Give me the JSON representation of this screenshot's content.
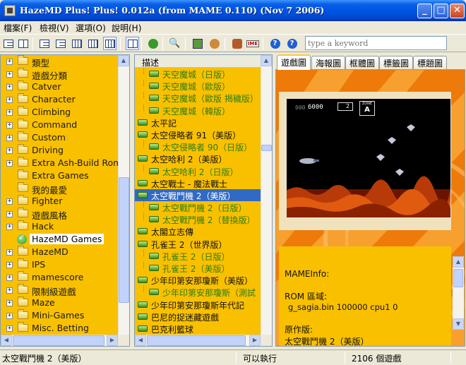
{
  "window": {
    "title": "HazeMD Plus! Plus! 0.012a (from MAME 0.110) (Nov  7 2006)"
  },
  "menu": [
    {
      "label": "檔案(F)"
    },
    {
      "label": "檢視(V)"
    },
    {
      "label": "選項(O)"
    },
    {
      "label": "說明(H)"
    }
  ],
  "toolbar": {
    "search_placeholder": "type a keyword",
    "icons": [
      "large-icons",
      "small-icons",
      "list-view",
      "details-view",
      "grouped-view",
      "folder-pane",
      "view-toggle",
      "refresh",
      "find",
      "play",
      "options",
      "plugins",
      "ime",
      "help",
      "about"
    ]
  },
  "folders": [
    {
      "label": "類型",
      "expander": "+",
      "icon": "folder"
    },
    {
      "label": "遊戲分類",
      "expander": "+",
      "icon": "folder"
    },
    {
      "label": "Catver",
      "expander": "+",
      "icon": "folder"
    },
    {
      "label": "Character",
      "expander": "+",
      "icon": "folder"
    },
    {
      "label": "Climbing",
      "expander": "+",
      "icon": "folder"
    },
    {
      "label": "Command",
      "expander": "+",
      "icon": "folder"
    },
    {
      "label": "Custom",
      "expander": "+",
      "icon": "folder"
    },
    {
      "label": "Driving",
      "expander": "+",
      "icon": "folder"
    },
    {
      "label": "Extra Ash-Build Rom",
      "expander": "+",
      "icon": "folder"
    },
    {
      "label": "Extra Games",
      "expander": "",
      "icon": "folder"
    },
    {
      "label": "我的最愛",
      "expander": "",
      "icon": "folder"
    },
    {
      "label": "Fighter",
      "expander": "+",
      "icon": "folder"
    },
    {
      "label": "遊戲風格",
      "expander": "+",
      "icon": "folder"
    },
    {
      "label": "Hack",
      "expander": "+",
      "icon": "folder"
    },
    {
      "label": "HazeMD Games",
      "expander": "",
      "icon": "check",
      "selected": true
    },
    {
      "label": "HazeMD",
      "expander": "+",
      "icon": "folder"
    },
    {
      "label": "IPS",
      "expander": "+",
      "icon": "folder"
    },
    {
      "label": "mamescore",
      "expander": "+",
      "icon": "folder"
    },
    {
      "label": "限制級遊戲",
      "expander": "+",
      "icon": "folder"
    },
    {
      "label": "Maze",
      "expander": "+",
      "icon": "folder"
    },
    {
      "label": "Mini-Games",
      "expander": "+",
      "icon": "folder"
    },
    {
      "label": "Misc. Betting",
      "expander": "+",
      "icon": "folder"
    }
  ],
  "list_header": {
    "description": "描述"
  },
  "games": [
    {
      "label": "天空魔城（日版）",
      "clone": true
    },
    {
      "label": "天空魔城（歐版）",
      "clone": true
    },
    {
      "label": "天空魔城（歐版 揭穢版）",
      "clone": true
    },
    {
      "label": "天空魔城（韓版）",
      "clone": true
    },
    {
      "label": "太平記",
      "clone": false
    },
    {
      "label": "太空侵略者 91（美版）",
      "clone": false
    },
    {
      "label": "太空侵略者 90（日版）",
      "clone": true
    },
    {
      "label": "太空哈利 2（美版）",
      "clone": false
    },
    {
      "label": "太空哈利 2（日版）",
      "clone": true
    },
    {
      "label": "太空戰士 - 魔法戰士",
      "clone": false
    },
    {
      "label": "太空戰鬥機 2（美版）",
      "clone": false,
      "selected": true
    },
    {
      "label": "太空戰鬥機 2（日版）",
      "clone": true
    },
    {
      "label": "太空戰鬥機 2（替換版）",
      "clone": true
    },
    {
      "label": "太閣立志傳",
      "clone": false
    },
    {
      "label": "孔雀王 2（世界版）",
      "clone": false
    },
    {
      "label": "孔雀王 2（日版）",
      "clone": true
    },
    {
      "label": "孔雀王 2（美版）",
      "clone": true
    },
    {
      "label": "少年印第安那瓊斯（美版）",
      "clone": false
    },
    {
      "label": "少年印第安那瓊斯（測試",
      "clone": true
    },
    {
      "label": "少年印第安那瓊斯年代記",
      "clone": false
    },
    {
      "label": "巴尼的捉迷藏遊戲",
      "clone": false
    },
    {
      "label": "巴克利籃球",
      "clone": false
    }
  ],
  "tabs": [
    {
      "label": "遊戲圖",
      "active": true
    },
    {
      "label": "海報圖"
    },
    {
      "label": "框體圖"
    },
    {
      "label": "標籤圖"
    },
    {
      "label": "標題圖"
    }
  ],
  "screenshot": {
    "score": "6000",
    "lives": "2",
    "zone_label": "ZONE",
    "zone": "A"
  },
  "info": {
    "heading": "MAMEInfo:",
    "rom_label": "ROM 區域:",
    "rom_line": "g_sagia.bin  100000 cpu1     0",
    "original_label": "原作版:",
    "original_value": "太空戰鬥機 2（美版）"
  },
  "status": {
    "game": "太空戰鬥機 2（美版）",
    "state": "可以執行",
    "count": "2106 個遊戲"
  },
  "colors": {
    "pane_bg": "#f9c000",
    "selection": "#316ac5",
    "clone_text": "#2f7d12",
    "title_blue": "#0054e3"
  }
}
